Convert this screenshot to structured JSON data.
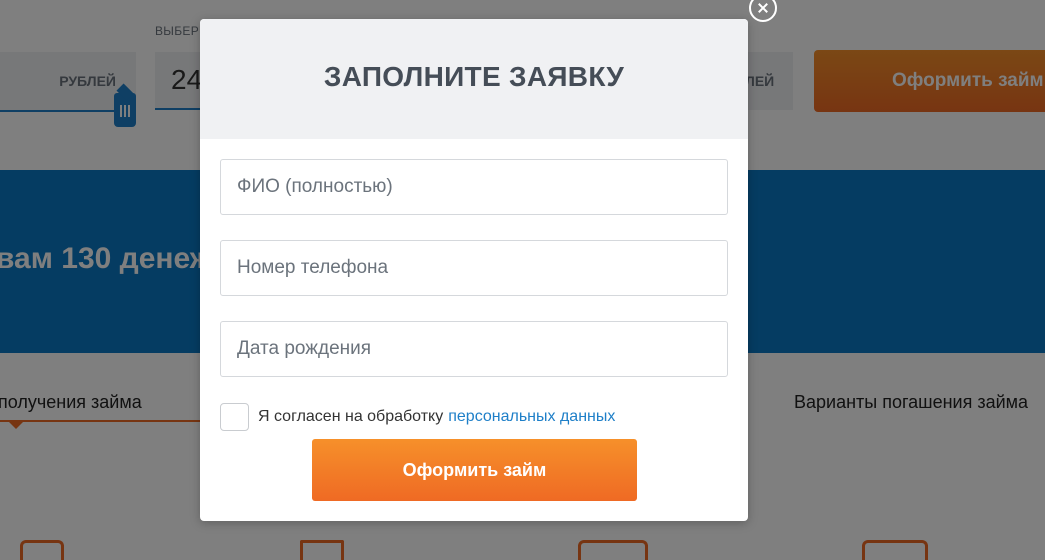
{
  "background": {
    "amount_unit": "РУБЛЕЙ",
    "choose_label": "ВЫБЕР",
    "term_value": "24",
    "days_unit": "ЛЕЙ",
    "top_button_label": "Оформить займ",
    "banner_text": "вам 130 денеж",
    "tab_left_label": "получения займа",
    "tab_right_label": "Варианты погашения займа",
    "accent_color": "#ef6a24",
    "brand_color": "#0b78c4"
  },
  "modal": {
    "title": "ЗАПОЛНИТЕ ЗАЯВКУ",
    "fields": {
      "full_name": {
        "placeholder": "ФИО (полностью)",
        "value": ""
      },
      "phone": {
        "placeholder": "Номер телефона",
        "value": ""
      },
      "birth_date": {
        "placeholder": "Дата рождения",
        "value": ""
      }
    },
    "consent_text": "Я согласен на обработку",
    "consent_link": "персональных данных",
    "consent_checked": false,
    "submit_label": "Оформить займ",
    "close_icon": "close-circle-icon"
  }
}
